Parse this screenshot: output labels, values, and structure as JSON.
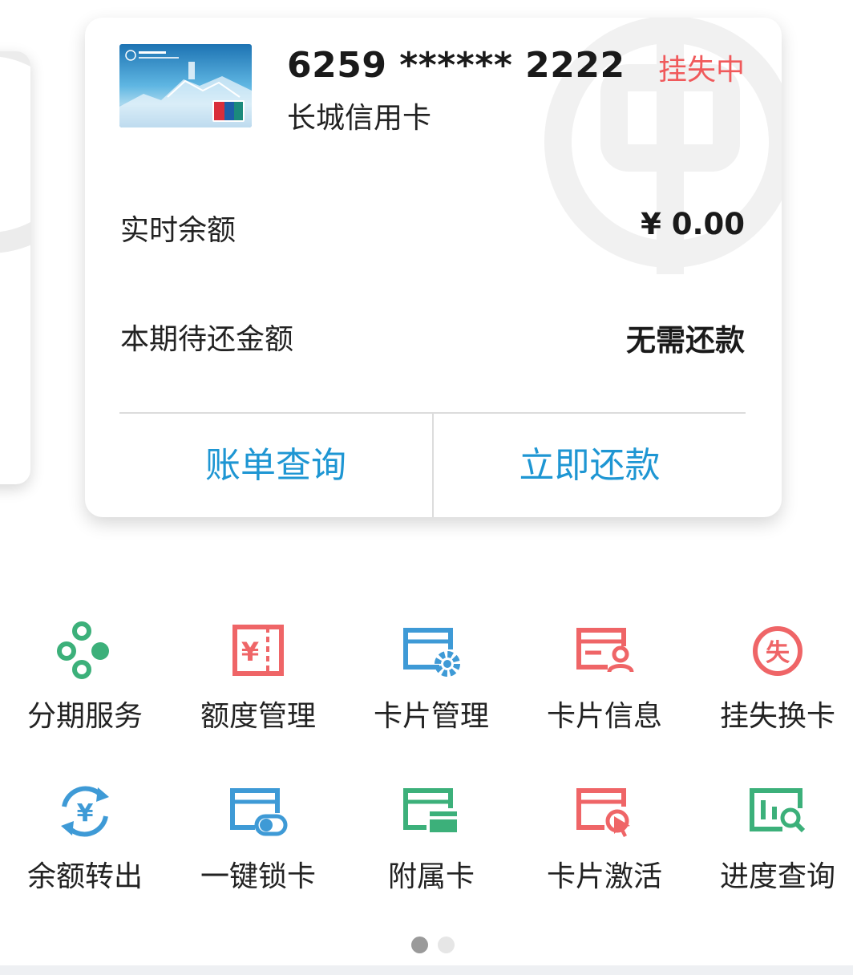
{
  "card": {
    "number": "6259 ****** 2222",
    "name": "长城信用卡",
    "status": "挂失中",
    "status_color": "#f0595b",
    "rows": [
      {
        "label": "实时余额",
        "value": "¥ 0.00"
      },
      {
        "label": "本期待还金额",
        "value": "无需还款"
      }
    ],
    "actions": [
      {
        "label": "账单查询"
      },
      {
        "label": "立即还款"
      }
    ],
    "action_color": "#1e96d3"
  },
  "services": [
    {
      "label": "分期服务",
      "icon": "installment-icon",
      "color": "#3cb07a"
    },
    {
      "label": "额度管理",
      "icon": "limit-icon",
      "color": "#ef6567"
    },
    {
      "label": "卡片管理",
      "icon": "card-settings-icon",
      "color": "#3e9ad6"
    },
    {
      "label": "卡片信息",
      "icon": "card-info-icon",
      "color": "#ef6567"
    },
    {
      "label": "挂失换卡",
      "icon": "report-loss-icon",
      "color": "#ef6567"
    },
    {
      "label": "余额转出",
      "icon": "balance-transfer-icon",
      "color": "#3e9ad6"
    },
    {
      "label": "一键锁卡",
      "icon": "lock-card-icon",
      "color": "#3e9ad6"
    },
    {
      "label": "附属卡",
      "icon": "supplementary-card-icon",
      "color": "#3cb07a"
    },
    {
      "label": "卡片激活",
      "icon": "card-activate-icon",
      "color": "#ef6567"
    },
    {
      "label": "进度查询",
      "icon": "progress-query-icon",
      "color": "#3cb07a"
    }
  ],
  "pager": {
    "total": 2,
    "active": 1
  }
}
